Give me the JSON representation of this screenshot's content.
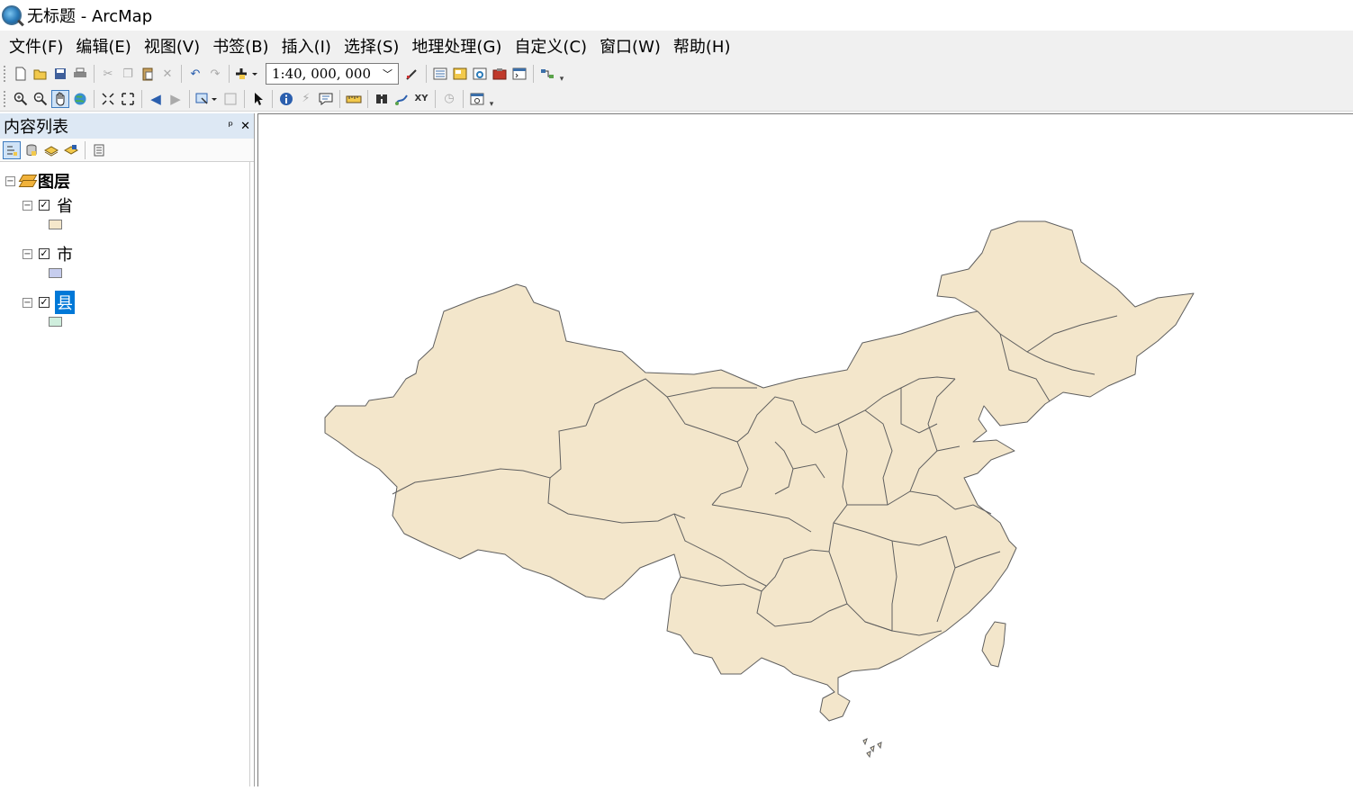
{
  "window": {
    "title": "无标题 - ArcMap"
  },
  "menu": [
    "文件(F)",
    "编辑(E)",
    "视图(V)",
    "书签(B)",
    "插入(I)",
    "选择(S)",
    "地理处理(G)",
    "自定义(C)",
    "窗口(W)",
    "帮助(H)"
  ],
  "toolbar": {
    "scale_value": "1:40, 000, 000"
  },
  "toc": {
    "title": "内容列表",
    "data_frame": "图层",
    "layers": [
      {
        "name": "省",
        "checked": true,
        "selected": false,
        "swatch_color": "#f5e7cb"
      },
      {
        "name": "市",
        "checked": true,
        "selected": false,
        "swatch_color": "#c6cdee"
      },
      {
        "name": "县",
        "checked": true,
        "selected": true,
        "swatch_color": "#cfeedd"
      }
    ]
  },
  "map": {
    "fill_color": "#f3e6cb",
    "boundary_color": "#5f5f5f"
  },
  "icons": {
    "toolbar1": [
      "new-document-icon",
      "open-icon",
      "save-icon",
      "print-icon",
      "cut-icon",
      "copy-icon",
      "paste-icon",
      "delete-icon",
      "undo-icon",
      "redo-icon",
      "add-data-icon",
      "editor-toolbar-icon",
      "toc-window-icon",
      "catalog-window-icon",
      "search-window-icon",
      "arctoolbox-icon",
      "python-window-icon",
      "model-builder-icon"
    ],
    "toolbar2": [
      "zoom-in-icon",
      "zoom-out-icon",
      "pan-icon",
      "full-extent-icon",
      "fixed-zoom-in-icon",
      "fixed-zoom-out-icon",
      "back-extent-icon",
      "forward-extent-icon",
      "select-features-icon",
      "clear-selection-icon",
      "select-elements-icon",
      "identify-icon",
      "hyperlink-icon",
      "html-popup-icon",
      "measure-icon",
      "find-icon",
      "find-route-icon",
      "goto-xy-icon",
      "time-slider-icon",
      "viewer-window-icon"
    ],
    "toc_tools": [
      "list-by-drawing-order-icon",
      "list-by-source-icon",
      "list-by-visibility-icon",
      "list-by-selection-icon",
      "options-icon"
    ]
  }
}
